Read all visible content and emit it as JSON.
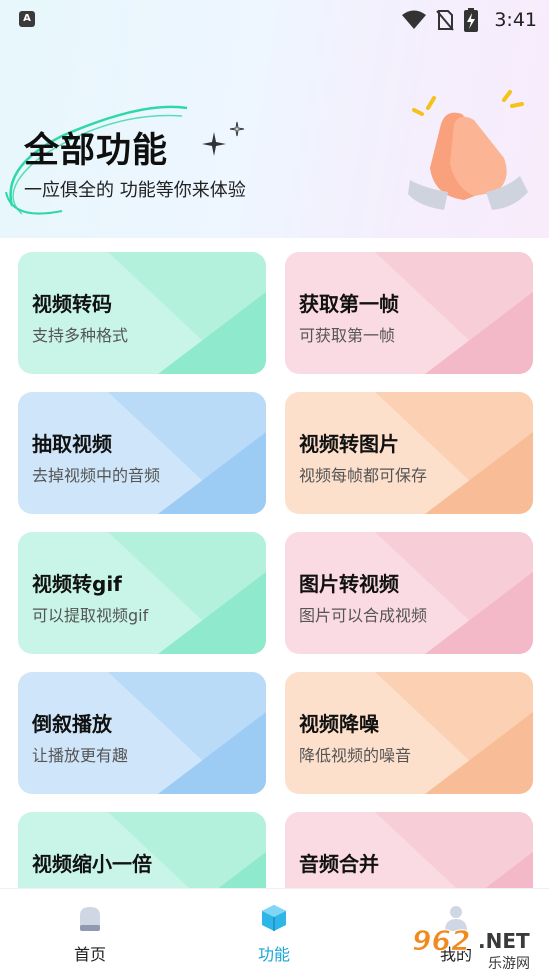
{
  "status_bar": {
    "time": "3:41",
    "notification_icon": "a-notification-icon",
    "wifi_icon": "wifi-icon",
    "no_sim_icon": "no-sim-icon",
    "battery_icon": "battery-charging-icon"
  },
  "header": {
    "title": "全部功能",
    "subtitle": "一应俱全的 功能等你来体验",
    "illustration": "clapping-hands-icon"
  },
  "features": [
    {
      "title": "视频转码",
      "subtitle": "支持多种格式",
      "color": "green"
    },
    {
      "title": "获取第一帧",
      "subtitle": "可获取第一帧",
      "color": "pink"
    },
    {
      "title": "抽取视频",
      "subtitle": "去掉视频中的音频",
      "color": "blue"
    },
    {
      "title": "视频转图片",
      "subtitle": "视频每帧都可保存",
      "color": "orange"
    },
    {
      "title": "视频转gif",
      "subtitle": "可以提取视频gif",
      "color": "green"
    },
    {
      "title": "图片转视频",
      "subtitle": "图片可以合成视频",
      "color": "pink"
    },
    {
      "title": "倒叙播放",
      "subtitle": "让播放更有趣",
      "color": "blue"
    },
    {
      "title": "视频降噪",
      "subtitle": "降低视频的噪音",
      "color": "orange"
    },
    {
      "title": "视频缩小一倍",
      "subtitle": "",
      "color": "green"
    },
    {
      "title": "音频合并",
      "subtitle": "",
      "color": "pink"
    }
  ],
  "colors": {
    "green": "#c8f5e7",
    "pink": "#fadbe3",
    "blue": "#cfe6fa",
    "orange": "#fde0cc",
    "accent": "#1aa6d8"
  },
  "bottom_nav": [
    {
      "label": "首页",
      "icon": "home-icon",
      "active": false
    },
    {
      "label": "功能",
      "icon": "cube-icon",
      "active": true
    },
    {
      "label": "我的",
      "icon": "profile-icon",
      "active": false
    }
  ],
  "watermark": {
    "text": "962.NET",
    "subtext": "乐游网"
  }
}
